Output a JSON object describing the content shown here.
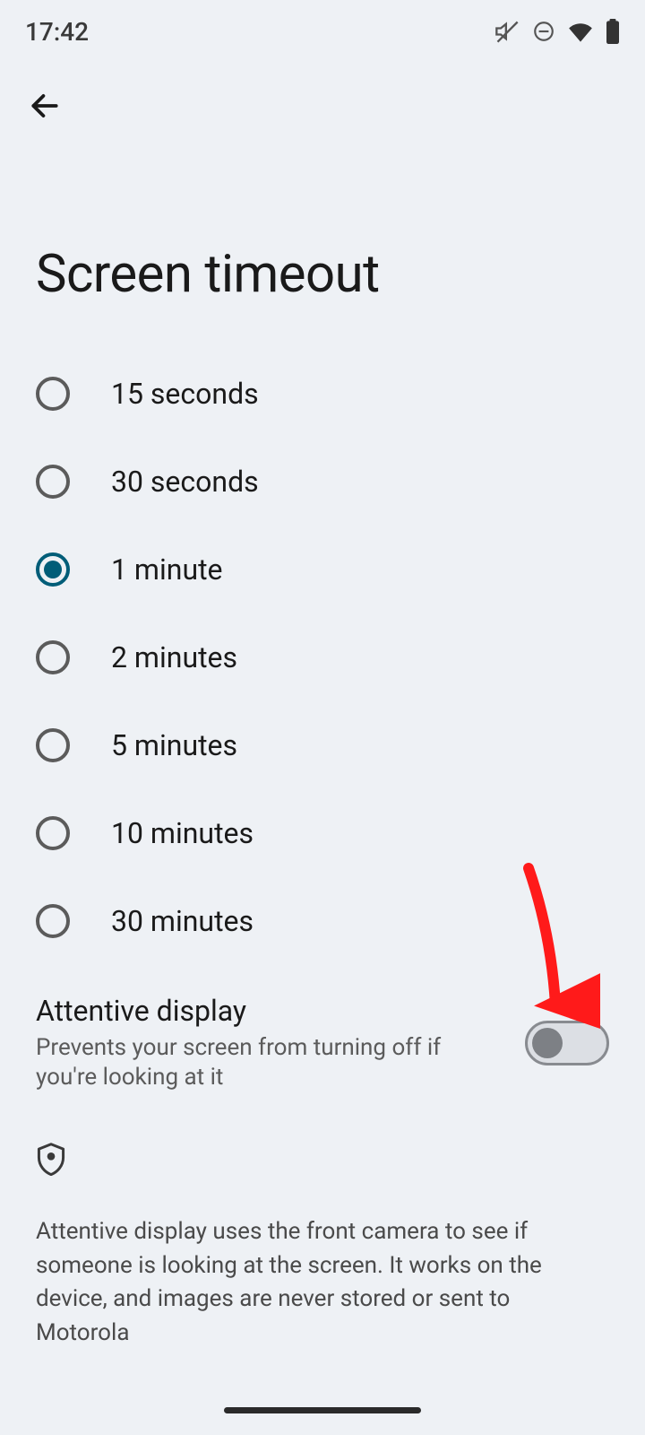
{
  "status": {
    "time": "17:42"
  },
  "page_title": "Screen timeout",
  "timeout_options": [
    {
      "label": "15 seconds",
      "selected": false
    },
    {
      "label": "30 seconds",
      "selected": false
    },
    {
      "label": "1 minute",
      "selected": true
    },
    {
      "label": "2 minutes",
      "selected": false
    },
    {
      "label": "5 minutes",
      "selected": false
    },
    {
      "label": "10 minutes",
      "selected": false
    },
    {
      "label": "30 minutes",
      "selected": false
    }
  ],
  "attentive_display": {
    "title": "Attentive display",
    "subtitle": "Prevents your screen from turning off if you're looking at it",
    "enabled": false,
    "info": "Attentive display uses the front camera to see if someone is looking at the screen. It works on the device, and images are never stored or sent to Motorola"
  },
  "annotation": {
    "type": "arrow",
    "color": "#ff1a1a",
    "target": "attentive-display-switch"
  }
}
